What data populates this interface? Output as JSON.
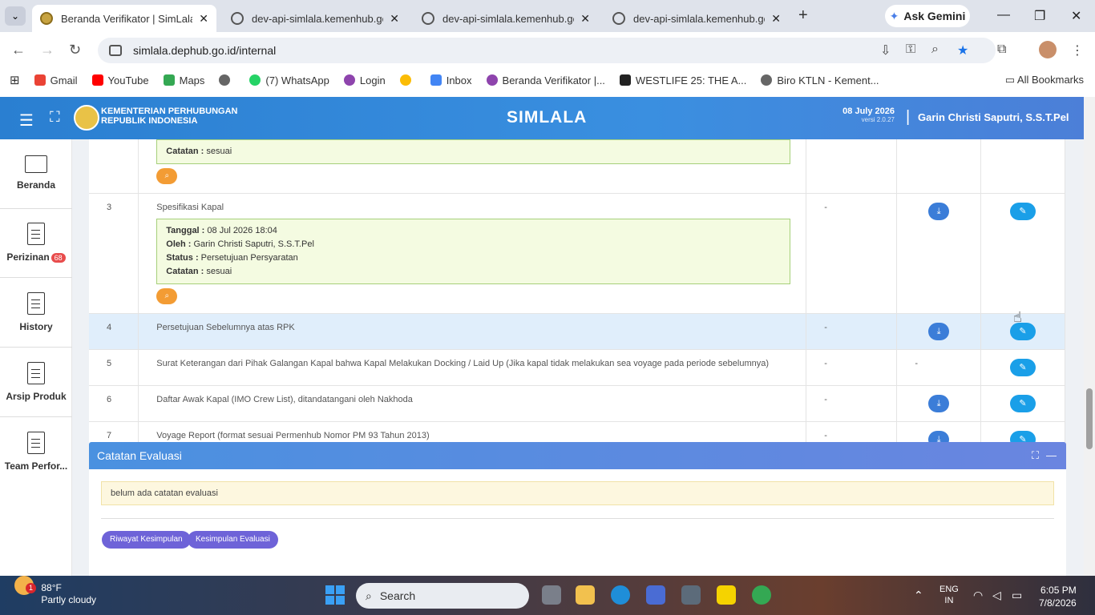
{
  "browser": {
    "tabs": [
      {
        "title": "Beranda Verifikator | SimLala",
        "active": true
      },
      {
        "title": "dev-api-simlala.kemenhub.go.id",
        "active": false
      },
      {
        "title": "dev-api-simlala.kemenhub.go.id",
        "active": false
      },
      {
        "title": "dev-api-simlala.kemenhub.go.id",
        "active": false
      }
    ],
    "ask_gemini": "Ask Gemini",
    "url": "simlala.dephub.go.id/internal",
    "bookmarks": [
      {
        "label": "Gmail",
        "color": "#ea4335"
      },
      {
        "label": "YouTube",
        "color": "#ff0000"
      },
      {
        "label": "Maps",
        "color": "#34a853"
      },
      {
        "label": "",
        "color": "#666666"
      },
      {
        "label": "(7) WhatsApp",
        "color": "#25d366"
      },
      {
        "label": "Login",
        "color": "#8e44ad"
      },
      {
        "label": "",
        "color": "#fbbc05"
      },
      {
        "label": "Inbox",
        "color": "#4285f4"
      },
      {
        "label": "Beranda Verifikator |...",
        "color": "#8e44ad"
      },
      {
        "label": "WESTLIFE 25: THE A...",
        "color": "#222222"
      },
      {
        "label": "Biro KTLN - Kement...",
        "color": "#666666"
      }
    ],
    "all_bookmarks": "All Bookmarks"
  },
  "header": {
    "org_line1": "KEMENTERIAN PERHUBUNGAN",
    "org_line2": "REPUBLIK INDONESIA",
    "brand": "SIMLALA",
    "date": "08 July 2026",
    "version": "versi 2.0.27",
    "user": "Garin Christi Saputri, S.S.T.Pel"
  },
  "sidebar": {
    "items": [
      {
        "label": "Beranda",
        "icon": "monitor-icon"
      },
      {
        "label": "Perizinan",
        "icon": "document-icon",
        "badge": "68"
      },
      {
        "label": "History",
        "icon": "document-icon"
      },
      {
        "label": "Arsip Produk",
        "icon": "document-icon"
      },
      {
        "label": "Team Perfor...",
        "icon": "document-icon"
      }
    ]
  },
  "table": {
    "partial_row": {
      "catatan_label": "Catatan :",
      "catatan_value": "sesuai"
    },
    "rows": [
      {
        "no": "3",
        "name": "Spesifikasi Kapal",
        "ket": "-",
        "has_download": true,
        "log": {
          "tanggal_label": "Tanggal :",
          "tanggal": "08 Jul 2026 18:04",
          "oleh_label": "Oleh :",
          "oleh": "Garin Christi Saputri, S.S.T.Pel",
          "status_label": "Status :",
          "status": "Persetujuan Persyaratan",
          "catatan_label": "Catatan :",
          "catatan": "sesuai"
        }
      },
      {
        "no": "4",
        "name": "Persetujuan Sebelumnya atas RPK",
        "ket": "-",
        "has_download": true
      },
      {
        "no": "5",
        "name": "Surat Keterangan dari Pihak Galangan Kapal bahwa Kapal Melakukan Docking / Laid Up (Jika kapal tidak melakukan sea voyage pada periode sebelumnya)",
        "ket": "-",
        "download_text": "-"
      },
      {
        "no": "6",
        "name": "Daftar Awak Kapal (IMO Crew List), ditandatangani oleh Nakhoda",
        "ket": "-",
        "has_download": true
      },
      {
        "no": "7",
        "name": "Voyage Report (format sesuai Permenhub Nomor PM 93 Tahun 2013)",
        "ket": "-",
        "has_download": true
      }
    ]
  },
  "evaluasi": {
    "title": "Catatan Evaluasi",
    "note": "belum ada catatan evaluasi",
    "btn_riwayat": "Riwayat Kesimpulan",
    "btn_kesimpulan": "Kesimpulan Evaluasi"
  },
  "taskbar": {
    "weather_temp": "88°F",
    "weather_desc": "Partly cloudy",
    "weather_badge": "1",
    "search": "Search",
    "lang1": "ENG",
    "lang2": "IN",
    "time": "6:05 PM",
    "date": "7/8/2026"
  }
}
